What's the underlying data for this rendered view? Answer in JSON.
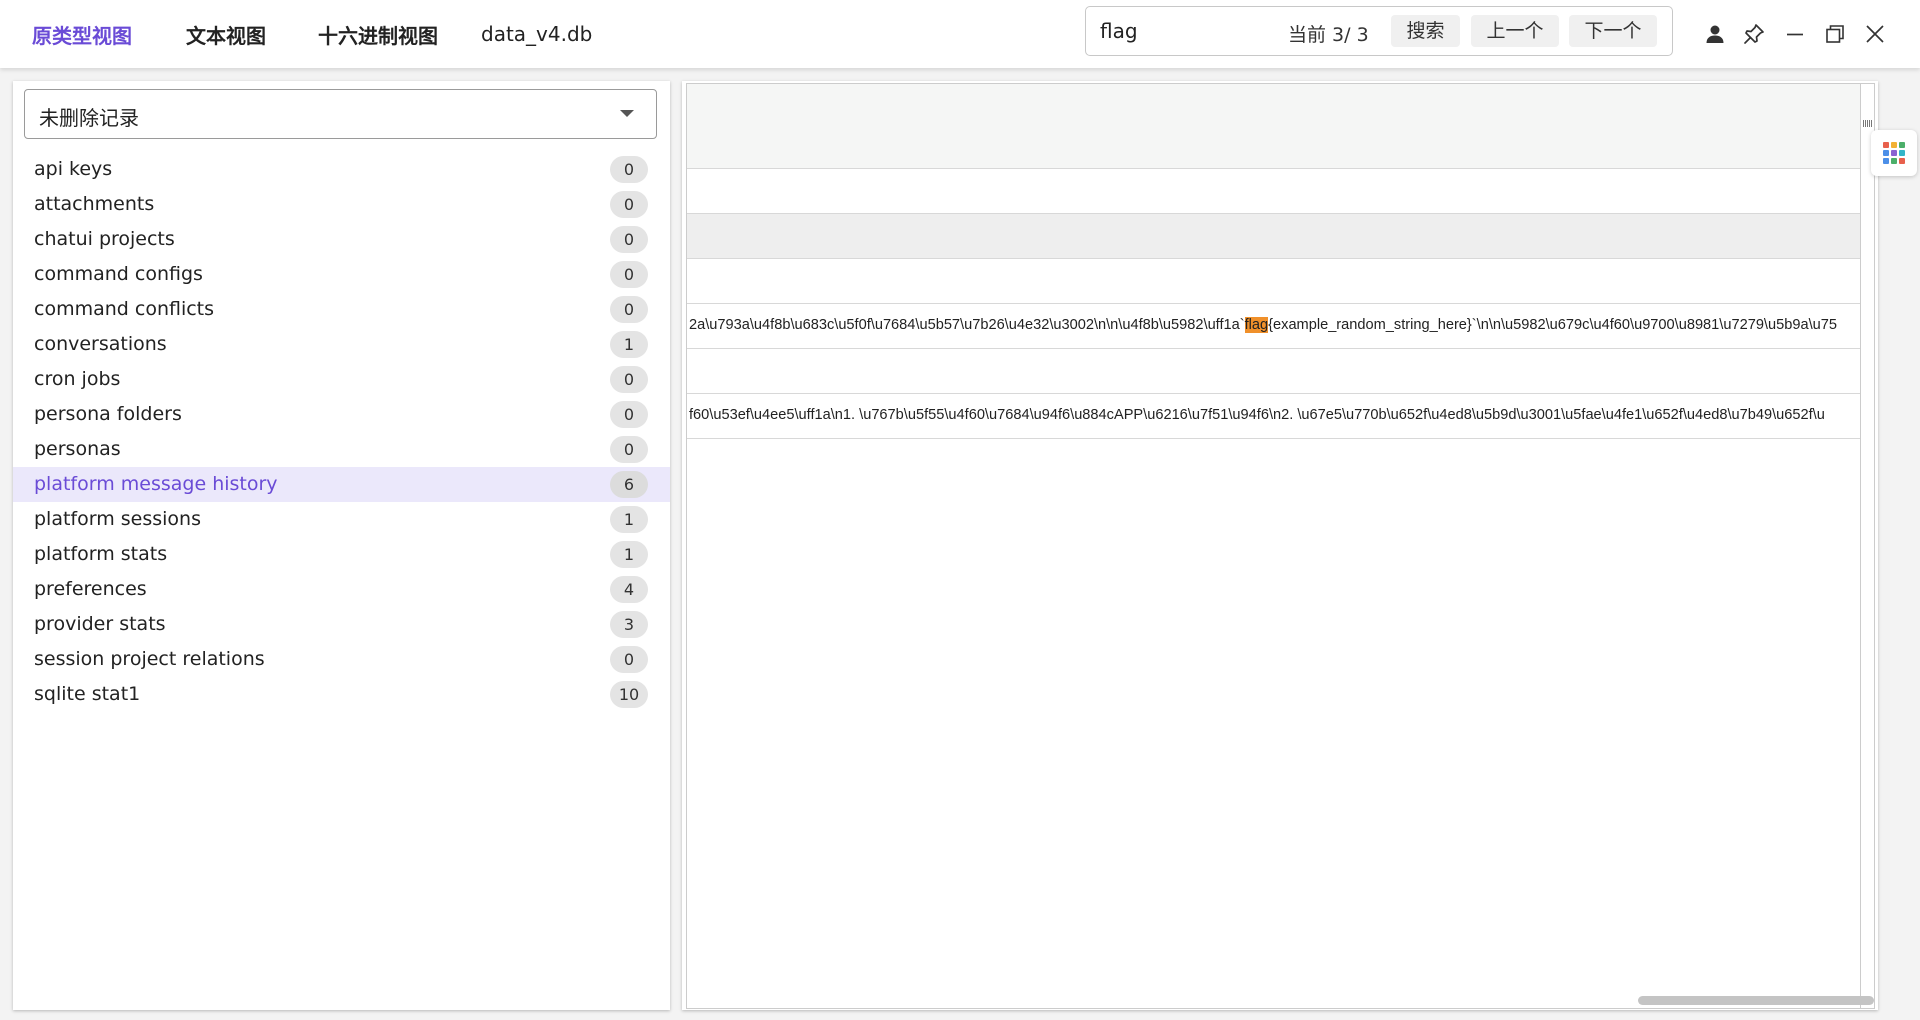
{
  "tabs": [
    {
      "label": "原类型视图",
      "active": true
    },
    {
      "label": "文本视图",
      "active": false
    },
    {
      "label": "十六进制视图",
      "active": false
    }
  ],
  "file_name": "data_v4.db",
  "search": {
    "value": "flag",
    "counter": "当前 3/ 3",
    "search_label": "搜索",
    "prev_label": "上一个",
    "next_label": "下一个"
  },
  "window_icons": [
    "user-icon",
    "pin-icon",
    "minimize-icon",
    "restore-icon",
    "close-icon"
  ],
  "filter_select": {
    "value": "未删除记录"
  },
  "tables": [
    {
      "name": "api keys",
      "count": "0"
    },
    {
      "name": "attachments",
      "count": "0"
    },
    {
      "name": "chatui projects",
      "count": "0"
    },
    {
      "name": "command configs",
      "count": "0"
    },
    {
      "name": "command conflicts",
      "count": "0"
    },
    {
      "name": "conversations",
      "count": "1"
    },
    {
      "name": "cron jobs",
      "count": "0"
    },
    {
      "name": "persona folders",
      "count": "0"
    },
    {
      "name": "personas",
      "count": "0"
    },
    {
      "name": "platform message history",
      "count": "6",
      "selected": true
    },
    {
      "name": "platform sessions",
      "count": "1"
    },
    {
      "name": "platform stats",
      "count": "1"
    },
    {
      "name": "preferences",
      "count": "4"
    },
    {
      "name": "provider stats",
      "count": "3"
    },
    {
      "name": "session project relations",
      "count": "0"
    },
    {
      "name": "sqlite stat1",
      "count": "10"
    }
  ],
  "grid": {
    "row6": {
      "before": "2a\\u793a\\u4f8b\\u683c\\u5f0f\\u7684\\u5b57\\u7b26\\u4e32\\u3002\\n\\n\\u4f8b\\u5982\\uff1a`",
      "match": "flag",
      "after": "{example_random_string_here}`\\n\\n\\u5982\\u679c\\u4f60\\u9700\\u8981\\u7279\\u5b9a\\u75"
    },
    "row8": "f60\\u53ef\\u4ee5\\uff1a\\n1. \\u767b\\u5f55\\u4f60\\u7684\\u94f6\\u884cAPP\\u6216\\u7f51\\u94f6\\n2. \\u67e5\\u770b\\u652f\\u4ed8\\u5b9d\\u3001\\u5fae\\u4fe1\\u652f\\u4ed8\\u7b49\\u652f\\u"
  },
  "side_button_icon": "apps-grid-icon",
  "colors": {
    "accent": "#6a4bd6",
    "selected_row_bg": "#ebe8fb",
    "highlight": "#f0902a"
  }
}
